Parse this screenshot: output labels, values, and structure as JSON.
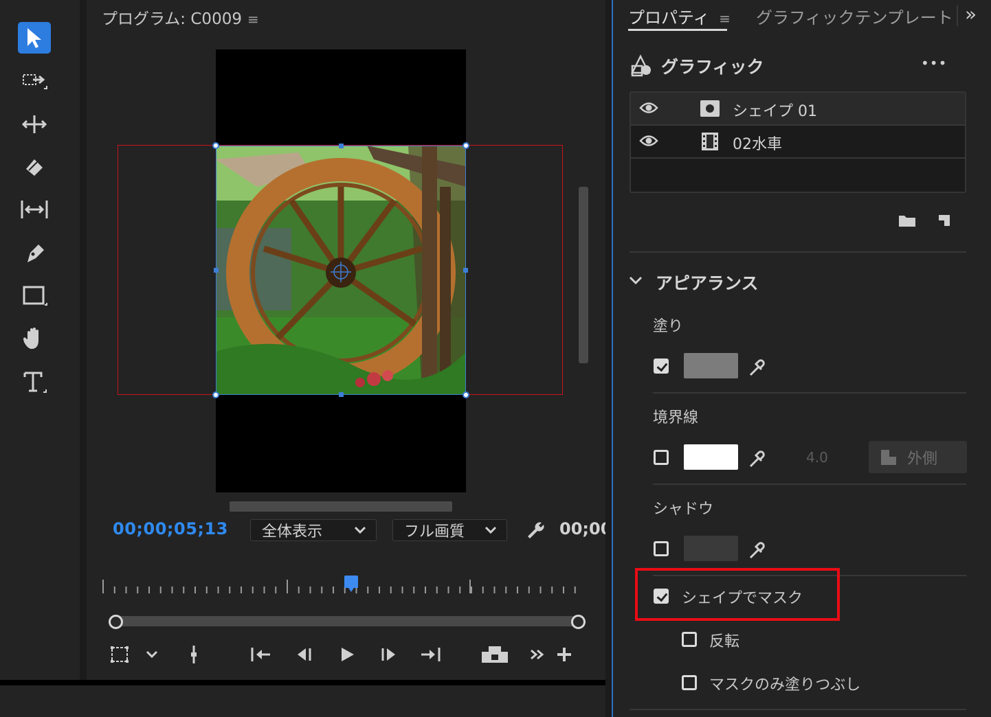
{
  "program": {
    "title": "プログラム: C0009",
    "menu_glyph": "≡",
    "timecode": "00;00;05;13",
    "fit_select": "全体表示",
    "quality_select": "フル画質",
    "end_timecode": "00;00"
  },
  "tools": [
    {
      "name": "selection-tool-icon",
      "active": true
    },
    {
      "name": "track-select-forward-tool-icon"
    },
    {
      "name": "ripple-edit-tool-icon"
    },
    {
      "name": "razor-tool-icon"
    },
    {
      "name": "slip-tool-icon"
    },
    {
      "name": "pen-tool-icon"
    },
    {
      "name": "rectangle-tool-icon"
    },
    {
      "name": "hand-tool-icon"
    },
    {
      "name": "type-tool-icon"
    }
  ],
  "panel": {
    "tabs": [
      {
        "label": "プロパティ",
        "active": true
      },
      {
        "label": "グラフィックテンプレート",
        "active": false
      }
    ],
    "tab_menu_glyph": "≡",
    "overflow_glyph": "»",
    "graphic": {
      "title": "グラフィック",
      "more_glyph": "•••",
      "layers": [
        {
          "label": "シェイプ 01",
          "icon": "shape-layer-icon"
        },
        {
          "label": "02水車",
          "icon": "clip-layer-icon"
        }
      ]
    },
    "appearance": {
      "title": "アピアランス",
      "fill": {
        "label": "塗り",
        "checked": true,
        "color": "#7c7c7c"
      },
      "stroke": {
        "label": "境界線",
        "checked": false,
        "color": "#ffffff",
        "width": "4.0",
        "position": "外側"
      },
      "shadow": {
        "label": "シャドウ",
        "checked": false,
        "color": "#3a3a3a"
      },
      "mask": {
        "label": "シェイプでマスク",
        "checked": true
      },
      "invert": {
        "label": "反転",
        "checked": false
      },
      "mask_fill": {
        "label": "マスクのみ塗りつぶし",
        "checked": false
      }
    }
  },
  "colors": {
    "accent_blue": "#2f8af0",
    "highlight_red": "#ea0c15",
    "panel_bg": "#232323"
  }
}
